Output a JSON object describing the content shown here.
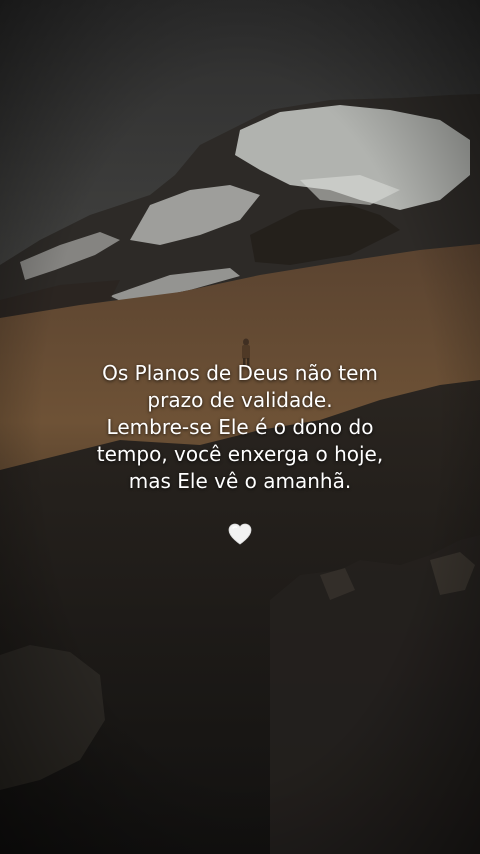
{
  "quote": {
    "lines": [
      "Os Planos de Deus não tem",
      "prazo de validade.",
      "Lembre-se Ele é o dono do",
      "tempo, você enxerga o hoje,",
      "mas Ele vê o amanhã."
    ]
  },
  "emoji": {
    "name": "white-heart-icon",
    "glyph": "🤍"
  },
  "colors": {
    "sky": "#3a3a39",
    "snow": "#d7d9d6",
    "rock": "#2a2622",
    "meadow": "#6b5036",
    "foreground": "#1d1b19",
    "text": "#ffffff"
  }
}
